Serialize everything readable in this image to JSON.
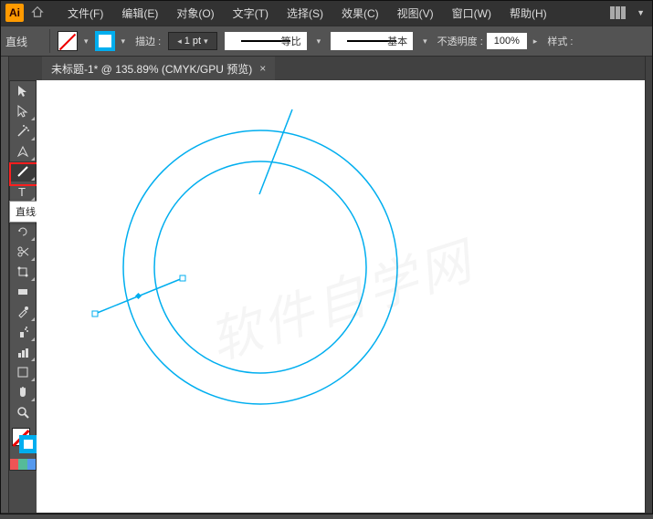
{
  "app": {
    "logo": "Ai"
  },
  "menu": {
    "items": [
      "文件(F)",
      "编辑(E)",
      "对象(O)",
      "文字(T)",
      "选择(S)",
      "效果(C)",
      "视图(V)",
      "窗口(W)",
      "帮助(H)"
    ]
  },
  "control": {
    "tool_label": "直线",
    "stroke_label": "描边 :",
    "stroke_value": "1 pt",
    "scale_label": "等比",
    "profile_label": "基本",
    "opacity_label": "不透明度 :",
    "opacity_value": "100%",
    "styles_label": "样式 :"
  },
  "tabs": {
    "active": {
      "title": "未标题-1* @ 135.89% (CMYK/GPU 预览)"
    }
  },
  "tooltip": "直线段工具 (\\)",
  "watermark": "软件自学网",
  "colors": {
    "stroke": "#00aeef",
    "highlight": "#ff1e1e"
  }
}
